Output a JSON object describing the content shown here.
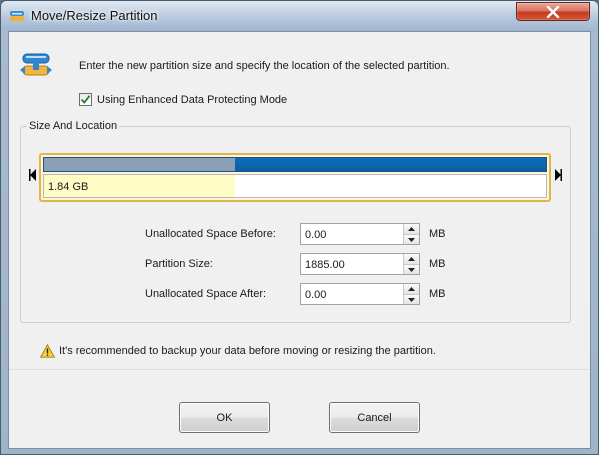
{
  "window": {
    "title": "Move/Resize Partition",
    "close_icon": "close-icon"
  },
  "header": {
    "icon": "move-resize-partition-icon",
    "description": "Enter the new partition size and specify the location of the selected partition."
  },
  "options": {
    "enhanced_mode_label": "Using Enhanced Data Protecting Mode",
    "enhanced_mode_checked": true
  },
  "size_location": {
    "group_label": "Size And Location",
    "partition_label": "1.84 GB",
    "used_fraction": 0.38,
    "colors": {
      "partition_bar": "#0a5fa6",
      "used_segment": "#8aa0b6",
      "selection_border": "#e0b54c",
      "fill": "#fffbc5"
    }
  },
  "fields": [
    {
      "label": "Unallocated Space Before:",
      "value": "0.00",
      "unit": "MB"
    },
    {
      "label": "Partition Size:",
      "value": "1885.00",
      "unit": "MB"
    },
    {
      "label": "Unallocated Space After:",
      "value": "0.00",
      "unit": "MB"
    }
  ],
  "warning": {
    "icon": "warning-icon",
    "text": "It's recommended to backup your data before moving or resizing the partition."
  },
  "buttons": {
    "ok_label": "OK",
    "cancel_label": "Cancel"
  }
}
